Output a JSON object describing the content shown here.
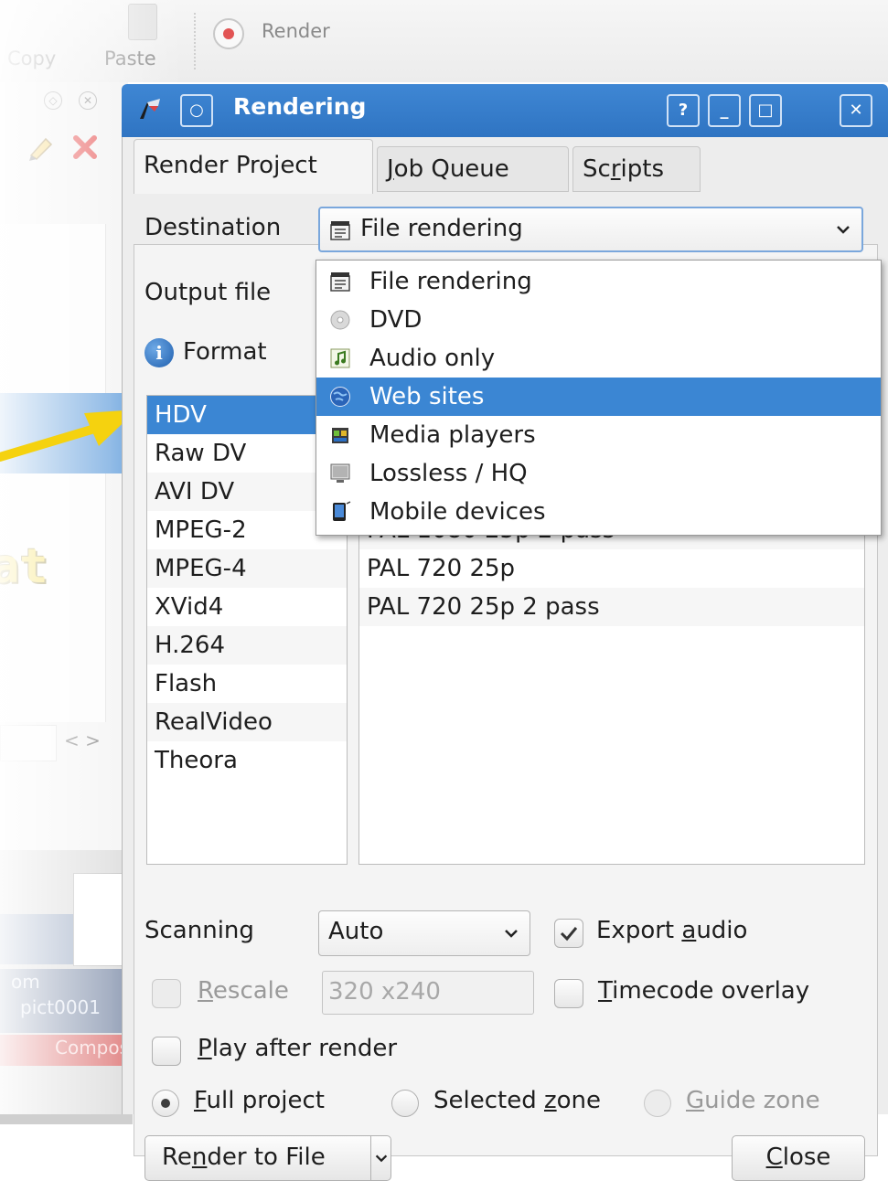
{
  "background": {
    "toolbar": {
      "copy_label": "Copy",
      "paste_label": "Paste",
      "render_label": "Render"
    },
    "overlay_text": "at",
    "timeline_clips": [
      "om",
      "pict0001",
      "Compos"
    ],
    "nav_arrows": "< >"
  },
  "dialog": {
    "title": "Rendering",
    "buttons": {
      "help": "?",
      "minimize": "_",
      "maximize": "□",
      "close": "✕",
      "menu": "○"
    },
    "tabs": [
      {
        "label_pre": "Render Pro",
        "label_u": "j",
        "label_post": "ect"
      },
      {
        "label_pre": "",
        "label_u": "J",
        "label_post": "ob Queue"
      },
      {
        "label_pre": "Sc",
        "label_u": "r",
        "label_post": "ipts"
      }
    ],
    "destination_label": "Destination",
    "destination_value": "File rendering",
    "output_file_label": "Output file",
    "format_label": "Format",
    "destination_options": [
      {
        "label": "File rendering",
        "icon": "film-clapper-icon"
      },
      {
        "label": "DVD",
        "icon": "disc-icon"
      },
      {
        "label": "Audio only",
        "icon": "music-note-icon"
      },
      {
        "label": "Web sites",
        "icon": "globe-icon"
      },
      {
        "label": "Media players",
        "icon": "media-player-icon"
      },
      {
        "label": "Lossless / HQ",
        "icon": "monitor-icon"
      },
      {
        "label": "Mobile devices",
        "icon": "mobile-phone-icon"
      }
    ],
    "highlighted_option": "Web sites",
    "formats": [
      "HDV",
      "Raw DV",
      "AVI DV",
      "MPEG-2",
      "MPEG-4",
      "XVid4",
      "H.264",
      "Flash",
      "RealVideo",
      "Theora"
    ],
    "selected_format": "HDV",
    "profiles": [
      "PAL 1080 25p 2 pass",
      "PAL 720 25p",
      "PAL 720 25p 2 pass"
    ],
    "scanning_label": "Scanning",
    "scanning_value": "Auto",
    "export_audio": {
      "pre": "Export ",
      "u": "a",
      "post": "udio",
      "checked": true
    },
    "rescale": {
      "pre": "",
      "u": "R",
      "post": "escale",
      "value": "320 x240",
      "checked": false
    },
    "timecode_overlay": {
      "pre": "",
      "u": "T",
      "post": "imecode overlay",
      "checked": false
    },
    "play_after_render": {
      "pre": "",
      "u": "P",
      "post": "lay after render",
      "checked": false
    },
    "full_project": {
      "pre": "",
      "u": "F",
      "post": "ull project"
    },
    "selected_zone": {
      "pre": "Selected ",
      "u": "z",
      "post": "one"
    },
    "guide_zone": {
      "pre": "",
      "u": "G",
      "post": "uide zone"
    },
    "render_button": {
      "pre": "Re",
      "u": "n",
      "post": "der to File"
    },
    "close_button": {
      "pre": "",
      "u": "C",
      "post": "lose"
    }
  },
  "colors": {
    "titlebar": "#3580cd",
    "selection": "#3b86d3",
    "arrow": "#f5d20f",
    "dialog_bg": "#ededed"
  }
}
